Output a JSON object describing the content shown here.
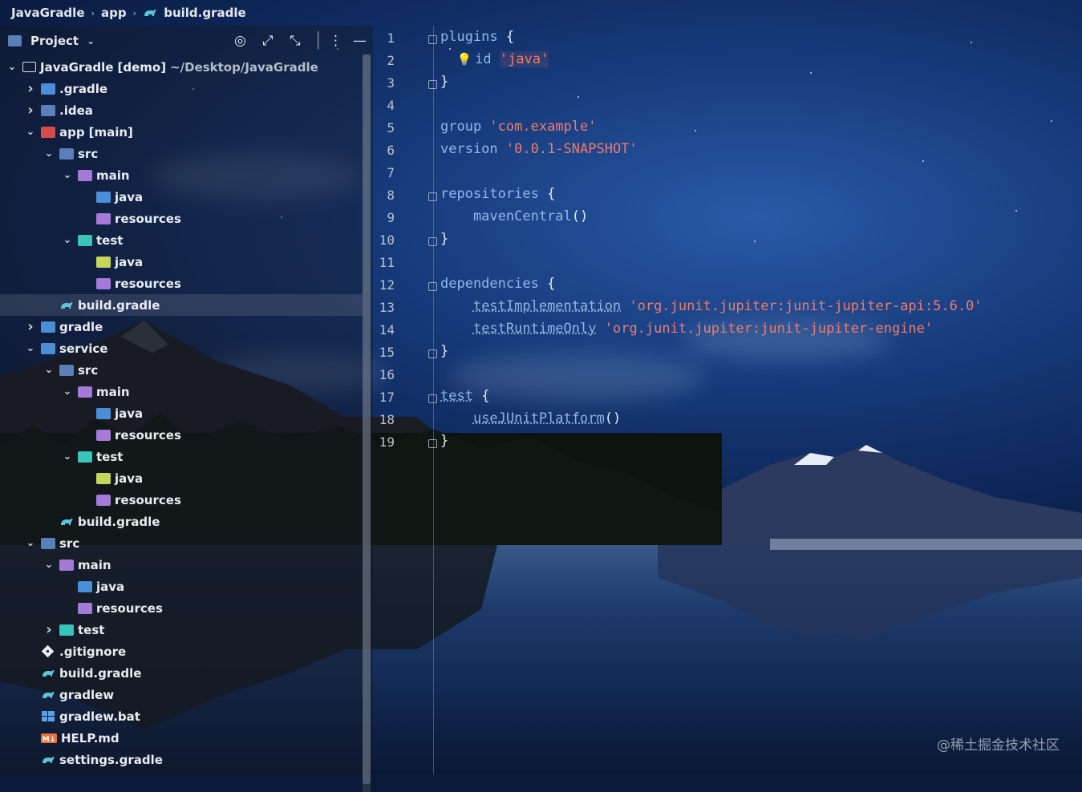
{
  "breadcrumb": {
    "items": [
      "JavaGradle",
      "app",
      "build.gradle"
    ]
  },
  "project_panel": {
    "title": "Project",
    "icons": [
      "target-icon",
      "expand-icon",
      "collapse-icon",
      "more-icon",
      "minimize-icon"
    ],
    "tree": [
      {
        "depth": 0,
        "chevron": "down",
        "icon": "module-outline",
        "label": "JavaGradle",
        "suffix": "[demo]",
        "extra": "~/Desktop/JavaGradle"
      },
      {
        "depth": 1,
        "chevron": "right",
        "icon": "folder-blue",
        "label": ".gradle"
      },
      {
        "depth": 1,
        "chevron": "right",
        "icon": "folder-slate",
        "label": ".idea"
      },
      {
        "depth": 1,
        "chevron": "down",
        "icon": "folder-red",
        "label": "app",
        "suffix": "[main]"
      },
      {
        "depth": 2,
        "chevron": "down",
        "icon": "folder-slate",
        "label": "src"
      },
      {
        "depth": 3,
        "chevron": "down",
        "icon": "folder-purple",
        "label": "main"
      },
      {
        "depth": 4,
        "chevron": "",
        "icon": "folder-blue",
        "label": "java"
      },
      {
        "depth": 4,
        "chevron": "",
        "icon": "folder-purple",
        "label": "resources"
      },
      {
        "depth": 3,
        "chevron": "down",
        "icon": "folder-teal",
        "label": "test"
      },
      {
        "depth": 4,
        "chevron": "",
        "icon": "folder-green",
        "label": "java"
      },
      {
        "depth": 4,
        "chevron": "",
        "icon": "folder-purple",
        "label": "resources"
      },
      {
        "depth": 2,
        "chevron": "",
        "icon": "gradle",
        "label": "build.gradle",
        "selected": true
      },
      {
        "depth": 1,
        "chevron": "right",
        "icon": "folder-blue",
        "label": "gradle"
      },
      {
        "depth": 1,
        "chevron": "down",
        "icon": "folder-blue",
        "label": "service"
      },
      {
        "depth": 2,
        "chevron": "down",
        "icon": "folder-slate",
        "label": "src"
      },
      {
        "depth": 3,
        "chevron": "down",
        "icon": "folder-purple",
        "label": "main"
      },
      {
        "depth": 4,
        "chevron": "",
        "icon": "folder-blue",
        "label": "java"
      },
      {
        "depth": 4,
        "chevron": "",
        "icon": "folder-purple",
        "label": "resources"
      },
      {
        "depth": 3,
        "chevron": "down",
        "icon": "folder-teal",
        "label": "test"
      },
      {
        "depth": 4,
        "chevron": "",
        "icon": "folder-green",
        "label": "java"
      },
      {
        "depth": 4,
        "chevron": "",
        "icon": "folder-purple",
        "label": "resources"
      },
      {
        "depth": 2,
        "chevron": "",
        "icon": "gradle",
        "label": "build.gradle"
      },
      {
        "depth": 1,
        "chevron": "down",
        "icon": "folder-slate",
        "label": "src"
      },
      {
        "depth": 2,
        "chevron": "down",
        "icon": "folder-purple",
        "label": "main"
      },
      {
        "depth": 3,
        "chevron": "",
        "icon": "folder-blue",
        "label": "java"
      },
      {
        "depth": 3,
        "chevron": "",
        "icon": "folder-purple",
        "label": "resources"
      },
      {
        "depth": 2,
        "chevron": "right",
        "icon": "folder-teal",
        "label": "test"
      },
      {
        "depth": 1,
        "chevron": "",
        "icon": "git",
        "label": ".gitignore"
      },
      {
        "depth": 1,
        "chevron": "",
        "icon": "gradle",
        "label": "build.gradle"
      },
      {
        "depth": 1,
        "chevron": "",
        "icon": "gradle",
        "label": "gradlew"
      },
      {
        "depth": 1,
        "chevron": "",
        "icon": "windows",
        "label": "gradlew.bat"
      },
      {
        "depth": 1,
        "chevron": "",
        "icon": "markdown",
        "label": "HELP.md"
      },
      {
        "depth": 1,
        "chevron": "",
        "icon": "gradle",
        "label": "settings.gradle"
      }
    ]
  },
  "editor": {
    "lines": [
      {
        "n": "1",
        "parts": [
          {
            "t": "plugins ",
            "c": "kw"
          },
          {
            "t": "{",
            "c": "brace"
          }
        ],
        "fold": true
      },
      {
        "n": "2",
        "parts": [
          {
            "t": "    id ",
            "c": "kw"
          },
          {
            "t": "'java'",
            "c": "str"
          }
        ],
        "bulb": true
      },
      {
        "n": "3",
        "parts": [
          {
            "t": "}",
            "c": "brace"
          }
        ],
        "fold": true
      },
      {
        "n": "4",
        "parts": []
      },
      {
        "n": "5",
        "parts": [
          {
            "t": "group ",
            "c": "kw"
          },
          {
            "t": "'com.example'",
            "c": "str"
          }
        ]
      },
      {
        "n": "6",
        "parts": [
          {
            "t": "version ",
            "c": "kw"
          },
          {
            "t": "'0.0.1-SNAPSHOT'",
            "c": "str"
          }
        ]
      },
      {
        "n": "7",
        "parts": []
      },
      {
        "n": "8",
        "parts": [
          {
            "t": "repositories ",
            "c": "kw"
          },
          {
            "t": "{",
            "c": "brace"
          }
        ],
        "fold": true
      },
      {
        "n": "9",
        "parts": [
          {
            "t": "    mavenCentral",
            "c": "kw"
          },
          {
            "t": "()",
            "c": "brace"
          }
        ]
      },
      {
        "n": "10",
        "parts": [
          {
            "t": "}",
            "c": "brace"
          }
        ],
        "fold": true
      },
      {
        "n": "11",
        "parts": []
      },
      {
        "n": "12",
        "parts": [
          {
            "t": "dependencies ",
            "c": "kw"
          },
          {
            "t": "{",
            "c": "brace"
          }
        ],
        "fold": true
      },
      {
        "n": "13",
        "parts": [
          {
            "t": "    ",
            "c": "kw"
          },
          {
            "t": "testImplementation",
            "c": "deprec"
          },
          {
            "t": " ",
            "c": "kw"
          },
          {
            "t": "'org.junit.jupiter:junit-jupiter-api:5.6.0'",
            "c": "str"
          }
        ]
      },
      {
        "n": "14",
        "parts": [
          {
            "t": "    ",
            "c": "kw"
          },
          {
            "t": "testRuntimeOnly",
            "c": "deprec"
          },
          {
            "t": " ",
            "c": "kw"
          },
          {
            "t": "'org.junit.jupiter:junit-jupiter-engine'",
            "c": "str"
          }
        ]
      },
      {
        "n": "15",
        "parts": [
          {
            "t": "}",
            "c": "brace"
          }
        ],
        "fold": true
      },
      {
        "n": "16",
        "parts": []
      },
      {
        "n": "17",
        "parts": [
          {
            "t": "test",
            "c": "deprec"
          },
          {
            "t": " ",
            "c": "kw"
          },
          {
            "t": "{",
            "c": "brace"
          }
        ],
        "fold": true
      },
      {
        "n": "18",
        "parts": [
          {
            "t": "    ",
            "c": "kw"
          },
          {
            "t": "useJUnitPlatform",
            "c": "deprec"
          },
          {
            "t": "()",
            "c": "brace"
          }
        ]
      },
      {
        "n": "19",
        "parts": [
          {
            "t": "}",
            "c": "brace"
          }
        ],
        "fold": true
      }
    ]
  },
  "watermark": "@稀土掘金技术社区",
  "colors": {
    "keyword": "#8fb8ea",
    "string": "#f07b6e",
    "selection": "#6e788c"
  }
}
